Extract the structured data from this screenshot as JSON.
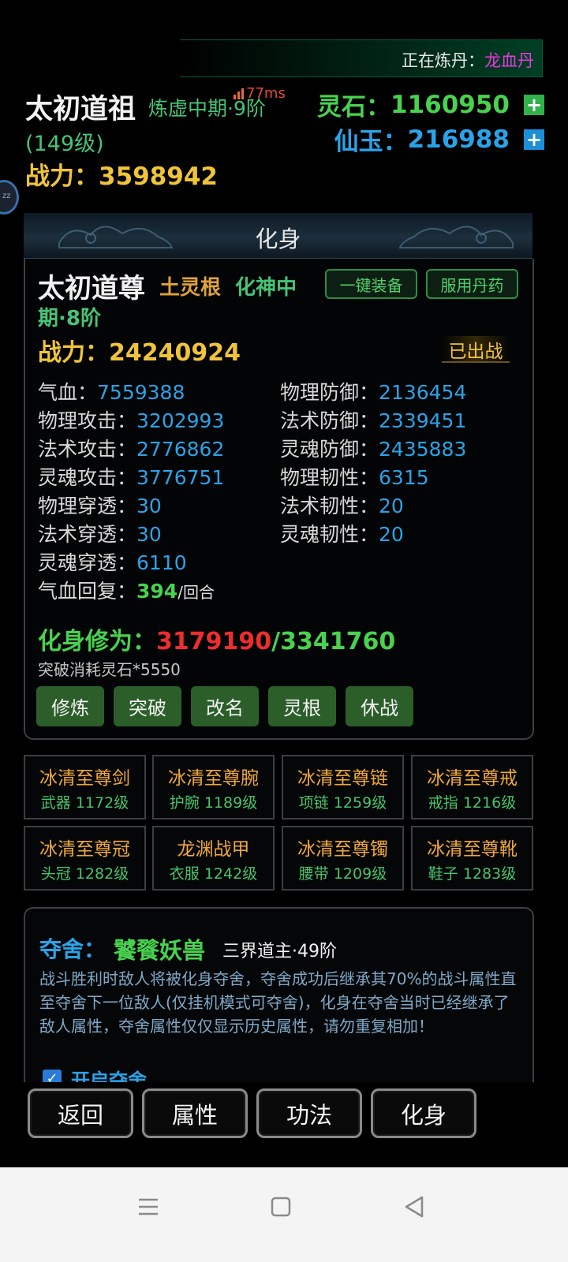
{
  "status": {
    "refining_label": "正在炼丹：",
    "refining_item": "龙血丹"
  },
  "player": {
    "name": "太初道祖",
    "realm": "炼虚中期·9阶",
    "level": "(149级)",
    "power_label": "战力：",
    "power_value": "3598942",
    "ping": "77ms"
  },
  "resources": {
    "spirit_stone_label": "灵石：",
    "spirit_stone_value": "1160950",
    "jade_label": "仙玉：",
    "jade_value": "216988",
    "plus": "+"
  },
  "side_bubble": "zz",
  "banner": {
    "title": "化身"
  },
  "avatar": {
    "name": "太初道尊",
    "root": "土灵根",
    "realm_line1": "化神中",
    "realm_line2": "期·8阶",
    "equip_all_button": "一键装备",
    "use_pill_button": "服用丹药",
    "power_label": "战力：",
    "power_value": "24240924",
    "deployed": "已出战",
    "stats_left": [
      {
        "label": "气血：",
        "value": "7559388"
      },
      {
        "label": "物理攻击：",
        "value": "3202993"
      },
      {
        "label": "法术攻击：",
        "value": "2776862"
      },
      {
        "label": "灵魂攻击：",
        "value": "3776751"
      },
      {
        "label": "物理穿透：",
        "value": "30"
      },
      {
        "label": "法术穿透：",
        "value": "30"
      },
      {
        "label": "灵魂穿透：",
        "value": "6110"
      }
    ],
    "stats_right": [
      {
        "label": "物理防御：",
        "value": "2136454"
      },
      {
        "label": "法术防御：",
        "value": "2339451"
      },
      {
        "label": "灵魂防御：",
        "value": "2435883"
      },
      {
        "label": "物理韧性：",
        "value": "6315"
      },
      {
        "label": "法术韧性：",
        "value": "20"
      },
      {
        "label": "灵魂韧性：",
        "value": "20"
      }
    ],
    "regen": {
      "label": "气血回复：",
      "value": "394",
      "unit": "/回合"
    },
    "cultivation_label": "化身修为：",
    "cultivation_current": "3179190",
    "cultivation_max": "/3341760",
    "breakthrough_cost": "突破消耗灵石*5550",
    "actions": [
      "修炼",
      "突破",
      "改名",
      "灵根",
      "休战"
    ]
  },
  "equipment": [
    {
      "name": "冰清至尊剑",
      "slot": "武器 1172级"
    },
    {
      "name": "冰清至尊腕",
      "slot": "护腕 1189级"
    },
    {
      "name": "冰清至尊链",
      "slot": "项链 1259级"
    },
    {
      "name": "冰清至尊戒",
      "slot": "戒指 1216级"
    },
    {
      "name": "冰清至尊冠",
      "slot": "头冠 1282级"
    },
    {
      "name": "龙渊战甲",
      "slot": "衣服 1242级"
    },
    {
      "name": "冰清至尊镯",
      "slot": "腰带 1209级"
    },
    {
      "name": "冰清至尊靴",
      "slot": "鞋子 1283级"
    }
  ],
  "possession": {
    "label": "夺舍：",
    "beast": "饕餮妖兽",
    "realm": "三界道主·49阶",
    "description": "战斗胜利时敌人将被化身夺舍，夺舍成功后继承其70%的战斗属性直至夺舍下一位敌人(仅挂机模式可夺舍)，化身在夺舍当时已经继承了敌人属性，夺舍属性仅仅显示历史属性，请勿重复相加！",
    "enable_label": "开启夺舍",
    "enabled": true
  },
  "nav": [
    "返回",
    "属性",
    "功法",
    "化身"
  ],
  "system_nav": {
    "menu_icon": "menu-icon",
    "home_icon": "home-icon",
    "back_icon": "back-icon"
  }
}
